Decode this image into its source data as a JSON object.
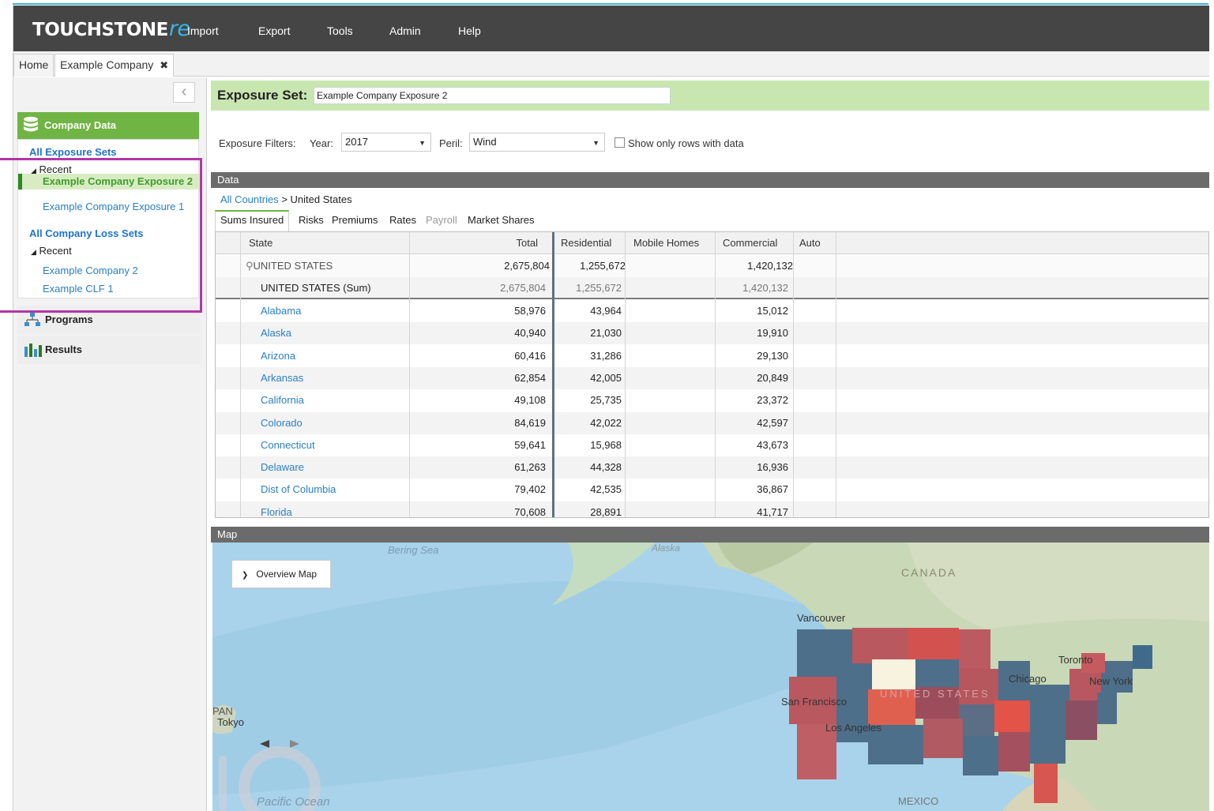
{
  "app": {
    "logo_main": "TOUCHSTONE",
    "logo_re": "re",
    "menu": [
      "Import",
      "Export",
      "Tools",
      "Admin",
      "Help"
    ]
  },
  "doc_tabs": {
    "home": "Home",
    "active": "Example Company",
    "close": "✖"
  },
  "sidebar": {
    "collapse": "‹",
    "company_data": "Company Data",
    "all_exposure_sets": "All Exposure Sets",
    "recent": "Recent",
    "exposure_items": [
      "Example Company Exposure 2",
      "Example Company Exposure 1"
    ],
    "all_loss_sets": "All Company Loss Sets",
    "loss_items": [
      "Example Company 2",
      "Example CLF 1"
    ],
    "programs": "Programs",
    "results": "Results"
  },
  "exposure_set": {
    "label": "Exposure Set:",
    "value": "Example Company Exposure 2"
  },
  "filters": {
    "label": "Exposure Filters:",
    "year_label": "Year:",
    "year": "2017",
    "peril_label": "Peril:",
    "peril": "Wind",
    "show_only": "Show only rows with data"
  },
  "data_panel": {
    "title": "Data",
    "breadcrumb_root": "All Countries",
    "breadcrumb_sep": ">",
    "breadcrumb_current": "United States",
    "tabs": [
      "Sums Insured",
      "Risks",
      "Premiums",
      "Rates",
      "Payroll",
      "Market Shares"
    ],
    "columns": [
      "State",
      "Total",
      "Residential",
      "Mobile Homes",
      "Commercial",
      "Auto"
    ],
    "country_row": {
      "state": "UNITED STATES",
      "total": "2,675,804",
      "residential": "1,255,672",
      "mobile": "",
      "commercial": "1,420,132",
      "auto": ""
    },
    "sum_row": {
      "state": "UNITED STATES (Sum)",
      "total": "2,675,804",
      "residential": "1,255,672",
      "mobile": "",
      "commercial": "1,420,132",
      "auto": ""
    },
    "rows": [
      {
        "state": "Alabama",
        "total": "58,976",
        "residential": "43,964",
        "commercial": "15,012"
      },
      {
        "state": "Alaska",
        "total": "40,940",
        "residential": "21,030",
        "commercial": "19,910"
      },
      {
        "state": "Arizona",
        "total": "60,416",
        "residential": "31,286",
        "commercial": "29,130"
      },
      {
        "state": "Arkansas",
        "total": "62,854",
        "residential": "42,005",
        "commercial": "20,849"
      },
      {
        "state": "California",
        "total": "49,108",
        "residential": "25,735",
        "commercial": "23,372"
      },
      {
        "state": "Colorado",
        "total": "84,619",
        "residential": "42,022",
        "commercial": "42,597"
      },
      {
        "state": "Connecticut",
        "total": "59,641",
        "residential": "15,968",
        "commercial": "43,673"
      },
      {
        "state": "Delaware",
        "total": "61,263",
        "residential": "44,328",
        "commercial": "16,936"
      },
      {
        "state": "Dist of Columbia",
        "total": "79,402",
        "residential": "42,535",
        "commercial": "36,867"
      },
      {
        "state": "Florida",
        "total": "70,608",
        "residential": "28,891",
        "commercial": "41,717"
      }
    ]
  },
  "map_panel": {
    "title": "Map",
    "overview_button": "Overview Map",
    "labels": {
      "bering_sea": "Bering Sea",
      "alaska": "Alaska",
      "canada": "CANADA",
      "vancouver": "Vancouver",
      "toronto": "Toronto",
      "chicago": "Chicago",
      "new_york": "New York",
      "san_francisco": "San Francisco",
      "united_states": "UNITED STATES",
      "los_angeles": "Los Angeles",
      "japan": "PAN",
      "tokyo": "Tokyo",
      "pacific_ocean": "Pacific Ocean",
      "mexico": "MEXICO"
    }
  }
}
